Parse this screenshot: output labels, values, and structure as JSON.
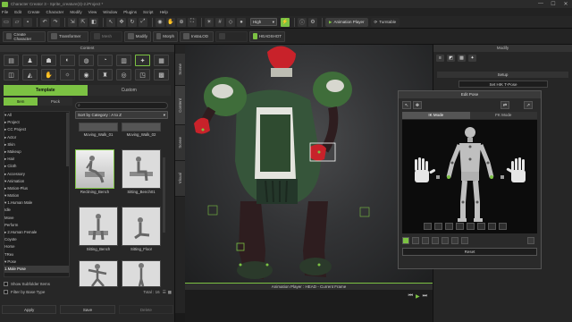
{
  "window": {
    "title": "Character Creator 3 - Sprite_creature(3)-2.iProject *",
    "controls": [
      "—",
      "☐",
      "✕"
    ]
  },
  "menu": [
    "File",
    "Edit",
    "Create",
    "Character",
    "Modify",
    "View",
    "Window",
    "Plugins",
    "Script",
    "Help"
  ],
  "toolbar1": {
    "quality": "High",
    "animation_player": "Animation Player",
    "turntable": "Turntable"
  },
  "toolbar2": {
    "items": [
      "Create Character",
      "Transformer",
      "Mesh",
      "Modify",
      "Morph",
      "InstaLOD",
      "Headshot"
    ],
    "headshot_label": "HEADSHOT"
  },
  "content": {
    "header": "Content",
    "tabs": {
      "template": "Template",
      "custom": "Custom"
    },
    "subtabs": {
      "item": "Item",
      "pack": "Pack"
    },
    "search_placeholder": "",
    "sort_label": "Sort by Category : A to Z",
    "tree": [
      "▾ All",
      "  ▸ Project",
      "    ▸ CC Project",
      "  ▸ Actor",
      "  ▸ Skin",
      "  ▸ Makeup",
      "  ▸ Hair",
      "  ▸ Cloth",
      "  ▸ Accessory",
      "  ▾ Animation",
      "    ▸ Motion-Plus",
      "    ▾ Motion",
      "      ▾ 1.Human Male",
      "          Idle",
      "          Move",
      "          Perform",
      "      ▸ 2.Human Female",
      "        Coyote",
      "        Horse",
      "        TRex",
      "    ▾ Pose",
      "        1.Male Pose"
    ],
    "selected_tree_index": 21,
    "top_thumbs": [
      "Moving_Walk_01",
      "Moving_Walk_02"
    ],
    "thumbs": [
      "Reclining_Bench",
      "Sitting_Bench01",
      "Sitting_Bench",
      "Sitting_Floor",
      "",
      ""
    ],
    "show_subfolder": "Show Subfolder Items",
    "filter_base_type": "Filter by Base Type",
    "total": "Total : 16",
    "footer_buttons": [
      "Apply",
      "Save",
      "Delete"
    ]
  },
  "side_tabs": [
    "Scene",
    "Content",
    "Scene",
    "Visual"
  ],
  "modify": {
    "header": "Modify",
    "setup": "Setup",
    "tpose": "Set HIK T-Pose"
  },
  "edit_pose": {
    "title": "Edit Pose",
    "modes": [
      "IK Mode",
      "FK Mode"
    ],
    "reset": "Reset"
  },
  "animation_bar": {
    "title": "Animation Player : HEAD - Current Frame"
  },
  "colors": {
    "accent": "#7cc243",
    "panel_bg": "#272727",
    "creature_red": "#c8222a",
    "armor_green": "#3f6d3a"
  }
}
